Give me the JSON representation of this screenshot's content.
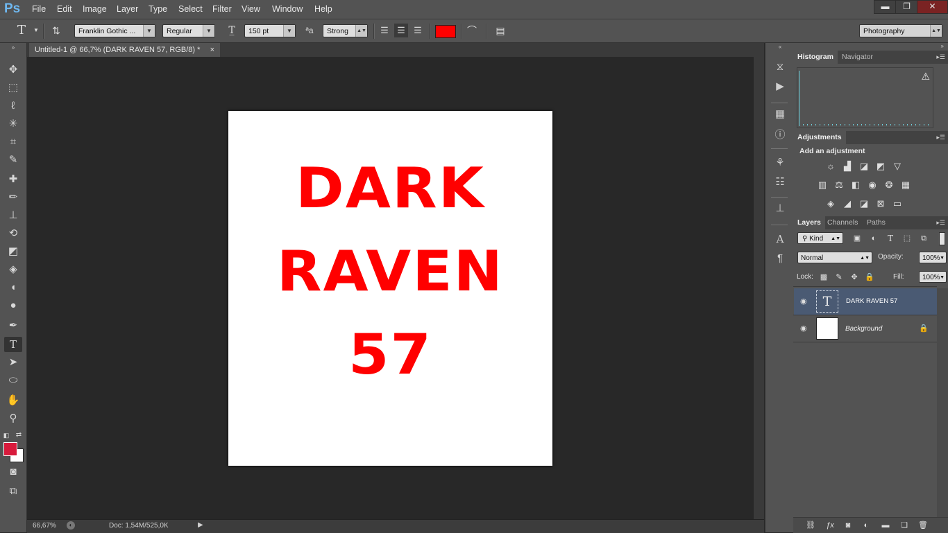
{
  "app": {
    "logo": "Ps"
  },
  "menu": [
    "File",
    "Edit",
    "Image",
    "Layer",
    "Type",
    "Select",
    "Filter",
    "View",
    "Window",
    "Help"
  ],
  "window_controls": {
    "minimize": "▬",
    "restore": "❐",
    "close": "✕"
  },
  "options": {
    "tool_glyph": "T",
    "font_family": "Franklin Gothic ...",
    "font_style": "Regular",
    "font_size": "150 pt",
    "aa_label": "ªa",
    "anti_alias": "Strong",
    "text_color": "#ff0000",
    "workspace": "Photography"
  },
  "document": {
    "tab_title": "Untitled-1 @ 66,7% (DARK RAVEN 57, RGB/8) *",
    "tab_close": "×",
    "lines": [
      "DARK",
      "RAVEN",
      "57"
    ],
    "text_color": "#ff0000"
  },
  "status": {
    "zoom": "66,67%",
    "doc_info": "Doc: 1,54M/525,0K"
  },
  "panels": {
    "histogram": {
      "tabs": [
        "Histogram",
        "Navigator"
      ],
      "warning": "⚠"
    },
    "adjustments": {
      "tab": "Adjustments",
      "heading": "Add an adjustment"
    },
    "layers": {
      "tabs": [
        "Layers",
        "Channels",
        "Paths"
      ],
      "filter_kind": "Kind",
      "blend_mode": "Normal",
      "opacity_label": "Opacity:",
      "opacity": "100%",
      "lock_label": "Lock:",
      "fill_label": "Fill:",
      "fill": "100%",
      "items": [
        {
          "name": "DARK RAVEN 57",
          "type": "text",
          "selected": true
        },
        {
          "name": "Background",
          "type": "background",
          "selected": false
        }
      ]
    }
  },
  "colors": {
    "foreground": "#d81b3c",
    "background": "#ffffff",
    "accent": "#4a5a73"
  }
}
